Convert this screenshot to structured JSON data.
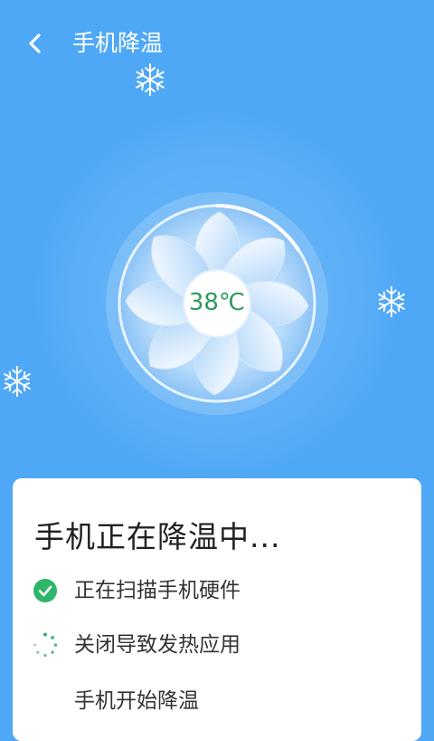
{
  "header": {
    "title": "手机降温",
    "back_icon": "chevron-left-icon"
  },
  "fan": {
    "temperature": "38℃"
  },
  "card": {
    "title": "手机正在降温中...",
    "steps": [
      {
        "label": "正在扫描手机硬件",
        "status": "done",
        "icon": "check-circle-icon"
      },
      {
        "label": "关闭导致发热应用",
        "status": "in-progress",
        "icon": "spinner-icon"
      },
      {
        "label": "手机开始降温",
        "status": "pending",
        "icon": ""
      }
    ]
  },
  "colors": {
    "background": "#4fa8f6",
    "accent_green": "#2fb56a",
    "temperature_text": "#2d9a5e"
  }
}
